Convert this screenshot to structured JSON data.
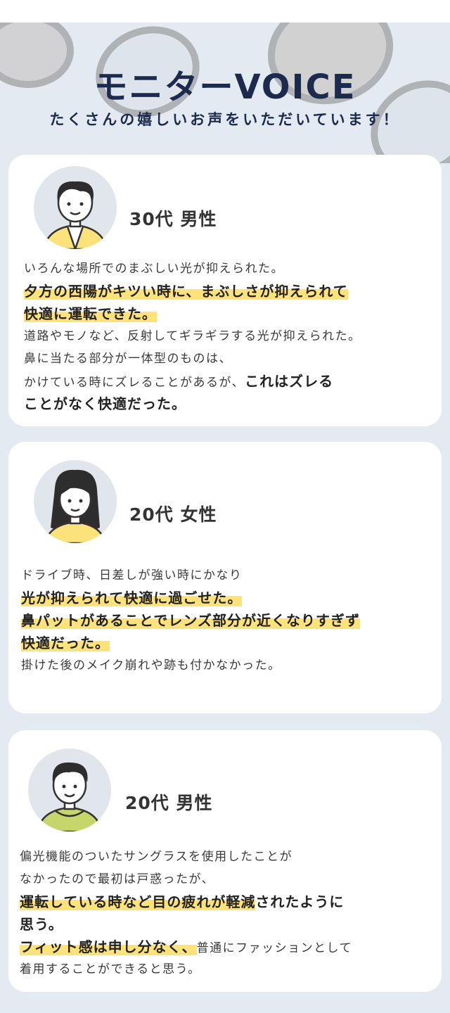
{
  "hero": {
    "title": "モニターVOICE",
    "subtitle": "たくさんの嬉しいお声をいただいています！"
  },
  "testimonials": [
    {
      "who": "30代 男性",
      "avatar_icon": "man-avatar-icon",
      "lines": [
        {
          "plain": "いろんな場所でのまぶしい光が抑えられた。"
        },
        {
          "highlight": "夕方の西陽がキツい時に、まぶしさが抑えられて"
        },
        {
          "highlight": "快適に運転できた。"
        },
        {
          "plain": "道路やモノなど、反射してギラギラする光が抑えられた。"
        },
        {
          "plain": "鼻に当たる部分が一体型のものは、"
        },
        {
          "plain": "かけている時にズレることがあるが、",
          "bold": "これはズレる"
        },
        {
          "bold": "ことがなく快適だった。"
        }
      ]
    },
    {
      "who": "20代 女性",
      "avatar_icon": "woman-avatar-icon",
      "lines": [
        {
          "plain": "ドライブ時、日差しが強い時にかなり"
        },
        {
          "highlight": "光が抑えられて快適に過ごせた。"
        },
        {
          "highlight": "鼻パットがあることでレンズ部分が近くなりすぎず"
        },
        {
          "highlight": "快適だった。"
        },
        {
          "plain": "掛けた後のメイク崩れや跡も付かなかった。"
        }
      ]
    },
    {
      "who": "20代 男性",
      "avatar_icon": "boy-hoodie-avatar-icon",
      "lines": [
        {
          "plain": "偏光機能のついたサングラスを使用したことが"
        },
        {
          "plain": "なかったので最初は戸惑ったが、"
        },
        {
          "highlight": "運転している時など目の疲れが軽減",
          "bold": "されたように"
        },
        {
          "bold": "思う。"
        },
        {
          "highlight": "フィット感は申し分なく、",
          "plain": "普通にファッションとして"
        },
        {
          "plain": "着用することができると思う。"
        }
      ]
    }
  ],
  "colors": {
    "page_bg": "#e4eaf1",
    "title": "#1c2b4d",
    "highlight": "#ffe37a"
  }
}
